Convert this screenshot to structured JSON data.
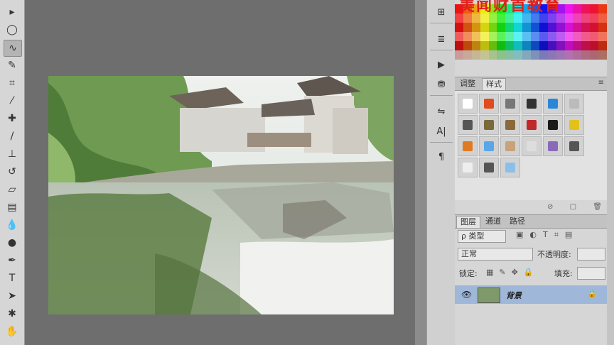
{
  "watermark": {
    "text": "美闻财首教育"
  },
  "toolbar": {
    "tools": [
      {
        "name": "move-tool-icon",
        "glyph": "▸"
      },
      {
        "name": "elliptical-marquee-tool-icon",
        "glyph": "◯"
      },
      {
        "name": "lasso-tool-icon",
        "glyph": "∿",
        "active": true
      },
      {
        "name": "quick-selection-tool-icon",
        "glyph": "✎"
      },
      {
        "name": "crop-tool-icon",
        "glyph": "⌗"
      },
      {
        "name": "eyedropper-tool-icon",
        "glyph": "⁄"
      },
      {
        "name": "healing-brush-tool-icon",
        "glyph": "✚"
      },
      {
        "name": "brush-tool-icon",
        "glyph": "/"
      },
      {
        "name": "clone-stamp-tool-icon",
        "glyph": "⊥"
      },
      {
        "name": "history-brush-tool-icon",
        "glyph": "↺"
      },
      {
        "name": "eraser-tool-icon",
        "glyph": "▱"
      },
      {
        "name": "gradient-tool-icon",
        "glyph": "▤"
      },
      {
        "name": "blur-tool-icon",
        "glyph": "💧"
      },
      {
        "name": "dodge-tool-icon",
        "glyph": "●"
      },
      {
        "name": "pen-tool-icon",
        "glyph": "✒"
      },
      {
        "name": "type-tool-icon",
        "glyph": "T"
      },
      {
        "name": "path-selection-tool-icon",
        "glyph": "➤"
      },
      {
        "name": "custom-shape-tool-icon",
        "glyph": "✱"
      },
      {
        "name": "hand-tool-icon",
        "glyph": "✋"
      }
    ]
  },
  "dock": {
    "buttons": [
      {
        "name": "history-panel-icon",
        "glyph": "⊞"
      },
      {
        "name": "properties-panel-icon",
        "glyph": "≣"
      },
      {
        "name": "actions-panel-icon",
        "glyph": "▶"
      },
      {
        "name": "adjust-panel-icon",
        "glyph": "⛃"
      },
      {
        "name": "tool-presets-icon",
        "glyph": "⇋"
      },
      {
        "name": "character-panel-icon",
        "glyph": "A|"
      },
      {
        "name": "paragraph-panel-icon",
        "glyph": "¶"
      }
    ]
  },
  "styles_panel": {
    "tabs": [
      {
        "label": "调整",
        "on": false
      },
      {
        "label": "样式",
        "on": true
      }
    ],
    "swatch_colors": [
      "#ff0000",
      "#f4a300",
      "#ffd400",
      "#0054a6",
      "#ec008c",
      "#ffffff",
      "#000000",
      "#333333",
      "#666666",
      "#999999",
      "#cccccc",
      "#ffffff",
      "#ff7f00",
      "#ff00ff",
      "#00ffff",
      "#0000ff",
      "#00ff00",
      "#ffff00"
    ]
  },
  "layers_panel": {
    "tabs": [
      {
        "label": "图层",
        "on": true
      },
      {
        "label": "通道",
        "on": false
      },
      {
        "label": "路径",
        "on": false
      }
    ],
    "filter_label": "ρ 类型",
    "blend_mode": "正常",
    "opacity_label": "不透明度:",
    "lock_label": "锁定:",
    "fill_label": "填充:",
    "layer_name": "背景"
  }
}
